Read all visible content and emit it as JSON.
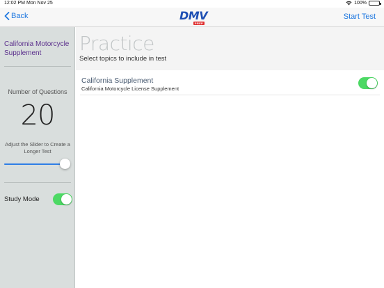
{
  "status_bar": {
    "time": "12:02 PM",
    "date": "Mon Nov 25",
    "battery": "100%",
    "battery_level": 1.0,
    "wifi_icon": "wifi-icon",
    "battery_icon": "battery-icon"
  },
  "nav": {
    "back_label": "Back",
    "back_icon": "chevron-left-icon",
    "logo_text": "DMV",
    "logo_badge": "PREP",
    "start_test_label": "Start Test"
  },
  "sidebar": {
    "title": "California Motorcycle Supplement",
    "questions_label": "Number of Questions",
    "questions_count": "20",
    "slider_hint": "Adjust the Slider to Create a Longer Test",
    "slider_value": 0.93,
    "study_mode_label": "Study Mode",
    "study_mode_on": true
  },
  "main": {
    "title": "Practice",
    "subtitle": "Select topics to include in test",
    "topics": [
      {
        "title": "California Supplement",
        "subtitle": "California Motorcycle License Supplement",
        "enabled": true
      }
    ]
  },
  "colors": {
    "accent": "#1f78e0",
    "toggle_on": "#4cd964",
    "sidebar_bg": "#d9dedd",
    "sidebar_title": "#5b2f8c",
    "logo": "#1e4fb3",
    "slider_fill": "#2f7ee6"
  }
}
